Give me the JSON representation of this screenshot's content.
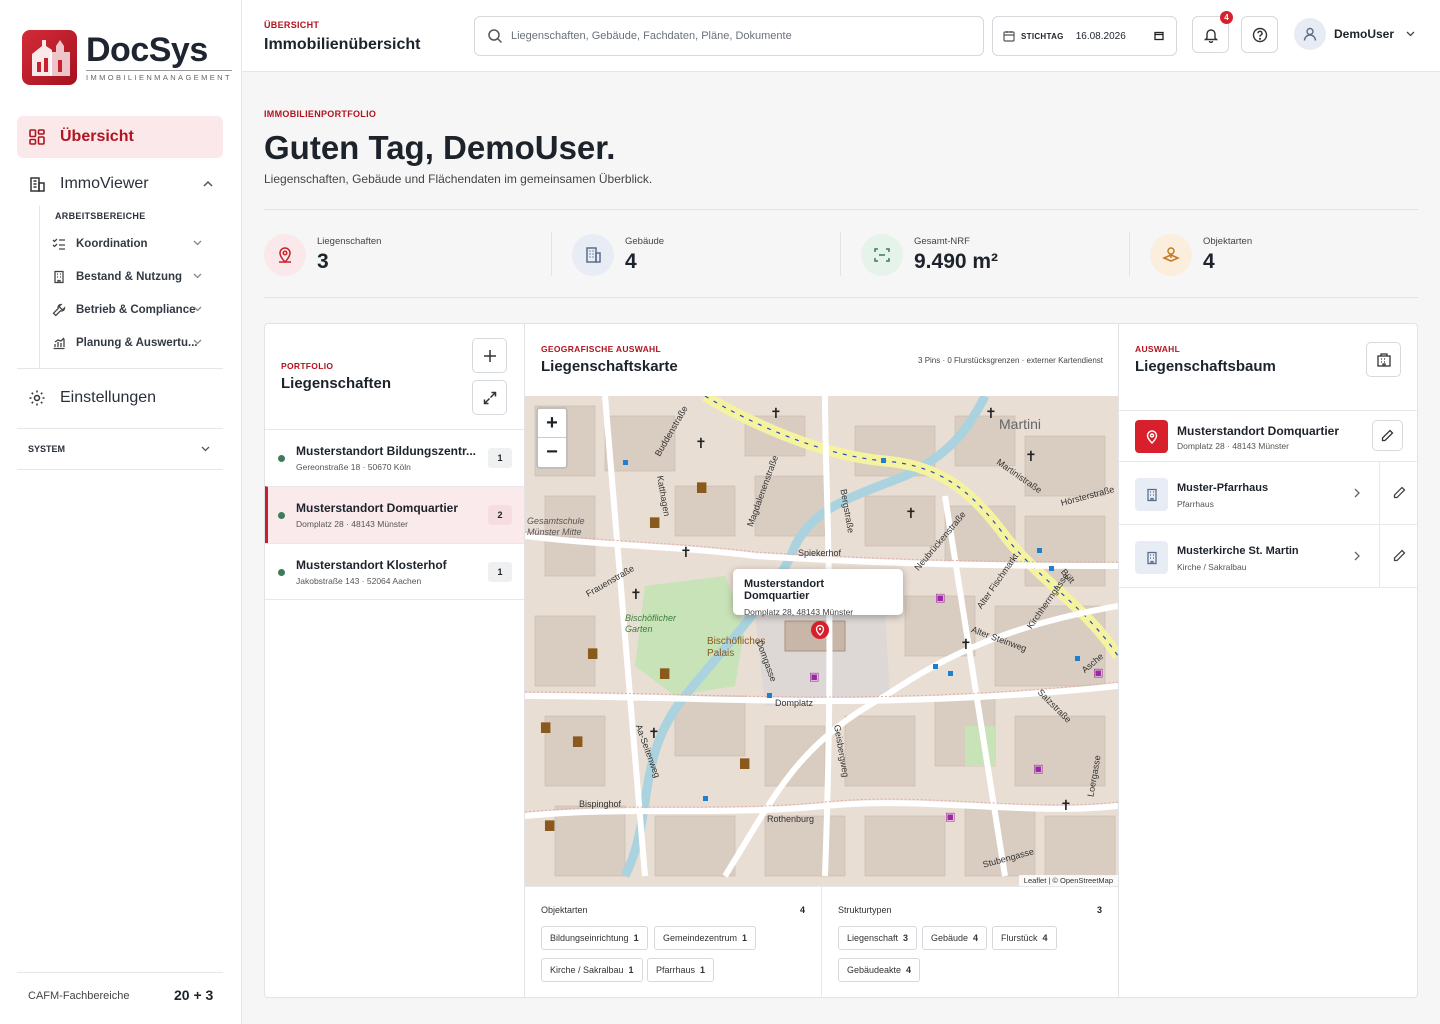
{
  "app": {
    "name": "DocSys",
    "subtitle": "IMMOBILIENMANAGEMENT"
  },
  "sidebar": {
    "overview": "Übersicht",
    "immoviewer": "ImmoViewer",
    "workspaces_heading": "ARBEITSBEREICHE",
    "workspaces": [
      {
        "label": "Koordination",
        "icon": "list-check-icon"
      },
      {
        "label": "Bestand & Nutzung",
        "icon": "building-icon"
      },
      {
        "label": "Betrieb & Compliance",
        "icon": "wrench-icon"
      },
      {
        "label": "Planung & Auswertu...",
        "icon": "chart-icon"
      }
    ],
    "settings": "Einstellungen",
    "system": "SYSTEM",
    "cafm_label": "CAFM-Fachbereiche",
    "cafm_value": "20 + 3"
  },
  "topbar": {
    "crumb": "ÜBERSICHT",
    "title": "Immobilienübersicht",
    "search_placeholder": "Liegenschaften, Gebäude, Fachdaten, Pläne, Dokumente",
    "date_label": "STICHTAG",
    "date_value": "16.08.2026",
    "notifications": "4",
    "user": "DemoUser"
  },
  "hero": {
    "eyebrow": "IMMOBILIENPORTFOLIO",
    "greeting": "Guten Tag, DemoUser.",
    "lead": "Liegenschaften, Gebäude und Flächendaten im gemeinsamen Überblick."
  },
  "stats": [
    {
      "label": "Liegenschaften",
      "value": "3",
      "color": "#fbe8ea"
    },
    {
      "label": "Gebäude",
      "value": "4",
      "color": "#e8edf5"
    },
    {
      "label": "Gesamt-NRF",
      "value": "9.490 m²",
      "color": "#e6f3ea"
    },
    {
      "label": "Objektarten",
      "value": "4",
      "color": "#fbeedd"
    }
  ],
  "portfolio": {
    "eyebrow": "PORTFOLIO",
    "title": "Liegenschaften",
    "items": [
      {
        "name": "Musterstandort Bildungszentr...",
        "address": "Gereonstraße 18 · 50670 Köln",
        "count": "1"
      },
      {
        "name": "Musterstandort Domquartier",
        "address": "Domplatz 28 · 48143 Münster",
        "count": "2"
      },
      {
        "name": "Musterstandort Klosterhof",
        "address": "Jakobstraße 143 · 52064 Aachen",
        "count": "1"
      }
    ]
  },
  "map": {
    "eyebrow": "GEOGRAFISCHE AUSWAHL",
    "title": "Liegenschaftskarte",
    "meta": "3 Pins · 0 Flurstücksgrenzen · externer Kartendienst",
    "popup_title": "Musterstandort Domquartier",
    "popup_address": "Domplatz 28, 48143 Münster",
    "attribution": "Leaflet | © OpenStreetMap",
    "labels": [
      "Martini",
      "Spiekerhof",
      "Domplatz",
      "Bischöfliches Palais",
      "Bischöflicher Garten",
      "Frauenstraße",
      "Rothenburg",
      "Bispinghof",
      "Alter Steinweg",
      "Salzstraße",
      "Stubengasse",
      "Aa-Seitenweg",
      "Gesamtschule Münster Mitte",
      "Buddenstraße",
      "Bergstraße",
      "Magdalenenstraße",
      "Katthagen",
      "Geisbergweg",
      "Domgasse",
      "Kirchherrngasse",
      "Alter Fischmarkt",
      "Martinistraße",
      "Neubrückenstraße",
      "Hörsterstraße",
      "Loergasse",
      "Bült",
      "Asche"
    ]
  },
  "filters": {
    "object_types_label": "Objektarten",
    "object_types_count": "4",
    "object_types": [
      {
        "label": "Bildungseinrichtung",
        "count": "1"
      },
      {
        "label": "Gemeindezentrum",
        "count": "1"
      },
      {
        "label": "Kirche / Sakralbau",
        "count": "1"
      },
      {
        "label": "Pfarrhaus",
        "count": "1"
      }
    ],
    "structure_label": "Strukturtypen",
    "structure_count": "3",
    "structure": [
      {
        "label": "Liegenschaft",
        "count": "3"
      },
      {
        "label": "Gebäude",
        "count": "4"
      },
      {
        "label": "Flurstück",
        "count": "4"
      },
      {
        "label": "Gebäudeakte",
        "count": "4"
      }
    ]
  },
  "tree": {
    "eyebrow": "AUSWAHL",
    "title": "Liegenschaftsbaum",
    "root": {
      "name": "Musterstandort Domquartier",
      "address": "Domplatz 28 · 48143 Münster"
    },
    "children": [
      {
        "name": "Muster-Pfarrhaus",
        "type": "Pfarrhaus"
      },
      {
        "name": "Musterkirche St. Martin",
        "type": "Kirche / Sakralbau"
      }
    ]
  },
  "colors": {
    "brand": "#b0141f",
    "accent_bg": "#fbe8ea",
    "status_green": "#3b7d58"
  }
}
